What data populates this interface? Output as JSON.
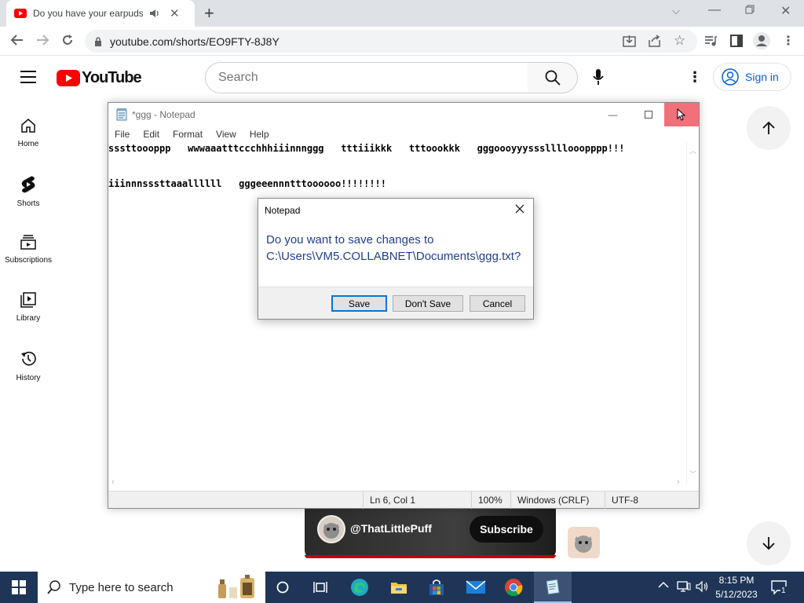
{
  "browser": {
    "tab_title": "Do you have your earpuds r",
    "url": "youtube.com/shorts/EO9FTY-8J8Y",
    "new_tab_symbol": "+"
  },
  "youtube": {
    "logo_text": "YouTube",
    "search_placeholder": "Search",
    "signin_label": "Sign in",
    "nav": [
      {
        "label": "Home",
        "icon": "home-icon"
      },
      {
        "label": "Shorts",
        "icon": "shorts-icon"
      },
      {
        "label": "Subscriptions",
        "icon": "subscriptions-icon"
      },
      {
        "label": "Library",
        "icon": "library-icon"
      },
      {
        "label": "History",
        "icon": "history-icon"
      }
    ],
    "channel_handle": "@ThatLittlePuff",
    "subscribe_label": "Subscribe"
  },
  "notepad": {
    "title": "*ggg - Notepad",
    "menu": [
      "File",
      "Edit",
      "Format",
      "View",
      "Help"
    ],
    "lines": [
      "sssttoooppp   wwwaaatttccchhhiiinnnggg   tttiiikkk   tttoookkk   gggoooyyysssllllooopppp!!!",
      "iiinnnsssttaaallllll   gggeeennntttoooooo!!!!!!!!"
    ],
    "status": {
      "position": "Ln 6, Col 1",
      "zoom": "100%",
      "line_ending": "Windows (CRLF)",
      "encoding": "UTF-8"
    }
  },
  "dialog": {
    "title": "Notepad",
    "message_line1": "Do you want to save changes to",
    "message_line2": "C:\\Users\\VM5.COLLABNET\\Documents\\ggg.txt?",
    "save": "Save",
    "dont_save": "Don't Save",
    "cancel": "Cancel"
  },
  "taskbar": {
    "search_placeholder": "Type here to search",
    "time": "8:15 PM",
    "date": "5/12/2023",
    "notification_count": "1"
  }
}
